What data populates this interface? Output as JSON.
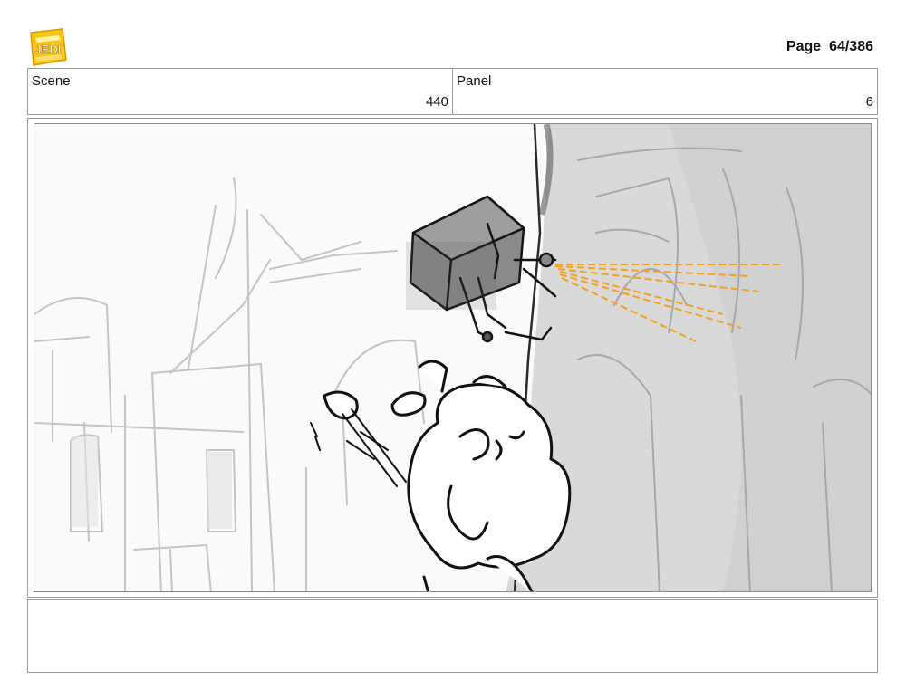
{
  "header": {
    "page_label": "Page",
    "page_number": "64/386",
    "logo_icon": "young-jedi-adventures-logo",
    "logo_color": "#f5c518"
  },
  "info": {
    "scene_label": "Scene",
    "scene_value": "440",
    "panel_label": "Panel",
    "panel_value": "6"
  },
  "panel": {
    "sketch": "storyboard-sketch",
    "spray_color": "#f2a11f"
  },
  "notes": {
    "text": ""
  }
}
